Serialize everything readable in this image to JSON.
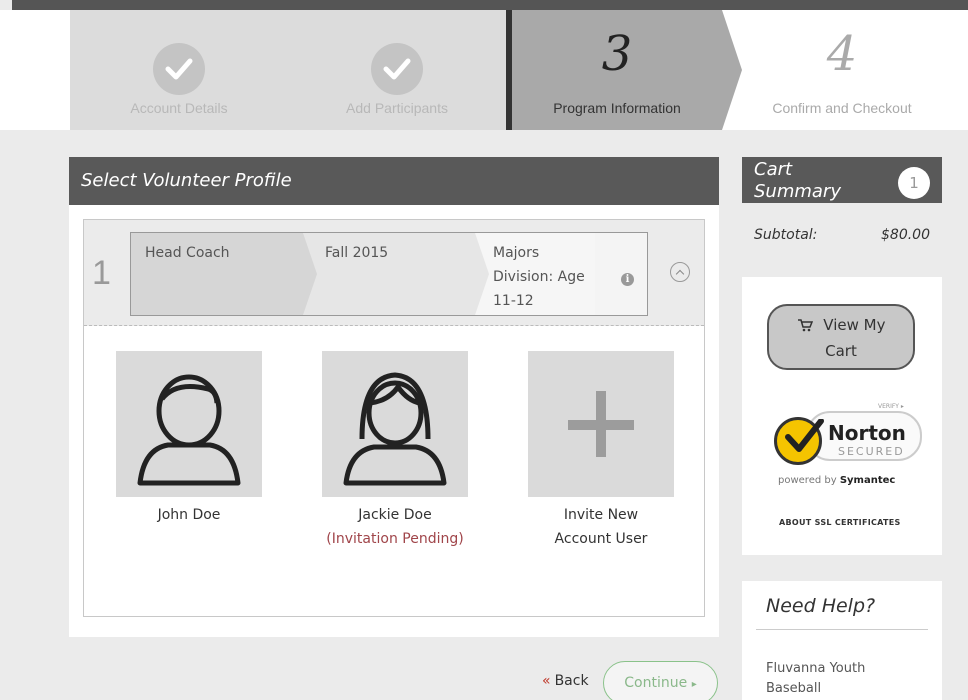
{
  "steps": [
    {
      "label": "Account Details",
      "state": "done"
    },
    {
      "label": "Add Participants",
      "state": "done"
    },
    {
      "number": "3",
      "label": "Program Information",
      "state": "current"
    },
    {
      "number": "4",
      "label": "Confirm and Checkout",
      "state": "next"
    }
  ],
  "panel": {
    "title": "Select Volunteer Profile",
    "row_number": "1",
    "breadcrumbs": [
      {
        "text": "Head Coach"
      },
      {
        "text": "Fall 2015"
      },
      {
        "text": "Majors Division: Age 11-12"
      }
    ],
    "info_icon": "i",
    "profiles": [
      {
        "name": "John Doe",
        "avatar": "male-avatar-icon"
      },
      {
        "name": "Jackie Doe",
        "status": "(Invitation Pending)",
        "avatar": "female-avatar-icon"
      },
      {
        "name": "Invite New Account User",
        "avatar": "plus-icon"
      }
    ]
  },
  "nav": {
    "back_chevron": "«",
    "back_label": "Back",
    "continue_label": "Continue",
    "continue_chevron": "▸"
  },
  "cart": {
    "title_line1": "Cart",
    "title_line2": "Summary",
    "count": "1",
    "subtotal_label": "Subtotal:",
    "subtotal_amount": "$80.00",
    "view_cart_line1": "View My",
    "view_cart_line2": "Cart",
    "norton_verify": "VERIFY ▸",
    "norton_brand": "Norton",
    "norton_secured": "SECURED",
    "norton_powered_prefix": "powered by",
    "norton_powered_brand": "Symantec",
    "ssl_link": "ABOUT SSL CERTIFICATES"
  },
  "help": {
    "title": "Need Help?",
    "org": "Fluvanna Youth Baseball"
  },
  "colors": {
    "header_bg": "#595959",
    "current_step_bg": "#a9a9a9",
    "pending_text": "#a0454a",
    "continue_border": "#8ac28a",
    "norton_yellow": "#f5c400"
  }
}
